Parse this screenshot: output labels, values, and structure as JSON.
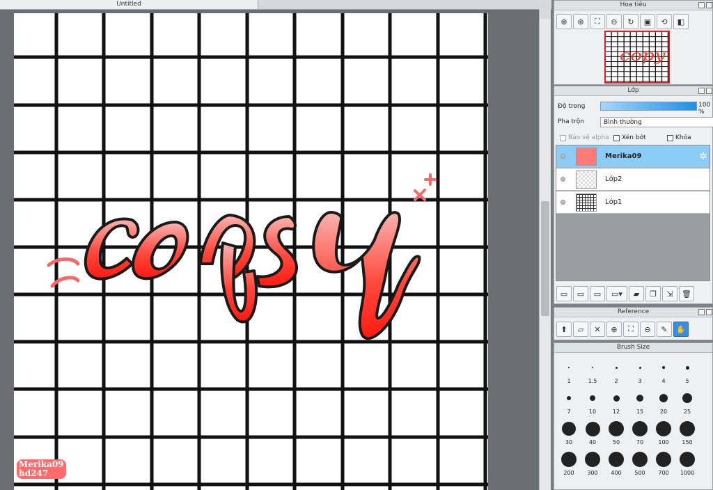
{
  "document": {
    "tab_title": "Untitled"
  },
  "watermark": {
    "line1": "Merika09",
    "line2": "hd247"
  },
  "navigator": {
    "title": "Hoa tiêu",
    "tools": [
      "zoom-fit-icon",
      "zoom-in-icon",
      "zoom-actual-icon",
      "zoom-out-icon",
      "rotate-icon",
      "fit-window-icon",
      "rotate-reset-icon",
      "flip-icon"
    ]
  },
  "layers": {
    "title": "Lớp",
    "opacity_label": "Độ trong",
    "opacity_value": "100 %",
    "opacity": 1.0,
    "blend_label": "Pha trộn",
    "blend_value": "Bình thường",
    "protect_alpha_label": "Bảo vệ alpha",
    "clipping_label": "Xén bớt",
    "lock_label": "Khóa",
    "items": [
      {
        "name": "Merika09",
        "selected": true
      },
      {
        "name": "Lớp2",
        "selected": false
      },
      {
        "name": "Lớp1",
        "selected": false
      }
    ],
    "toolbar": [
      "new-layer-icon",
      "new-layer-8bit-icon",
      "new-layer-1bit-icon",
      "new-layer-menu-icon",
      "folder-icon",
      "duplicate-icon",
      "merge-icon",
      "delete-icon"
    ]
  },
  "reference": {
    "title": "Reference",
    "tools": [
      "load-icon",
      "open-folder-icon",
      "close-icon",
      "zoom-in-icon",
      "fit-icon",
      "zoom-out-icon",
      "eyedropper-icon",
      "hand-icon"
    ]
  },
  "brush_size": {
    "title": "Brush Size",
    "sizes": [
      "1",
      "1.5",
      "2",
      "3",
      "4",
      "5",
      "7",
      "10",
      "12",
      "15",
      "20",
      "25",
      "30",
      "40",
      "50",
      "70",
      "100",
      "150",
      "200",
      "300",
      "400",
      "500",
      "700",
      "1000"
    ]
  },
  "colors": {
    "accent": "#3a8ee0",
    "selected_layer": "#8ccdf7",
    "lettering_top": "#f8a7a4",
    "lettering_bottom": "#ff1e12"
  }
}
